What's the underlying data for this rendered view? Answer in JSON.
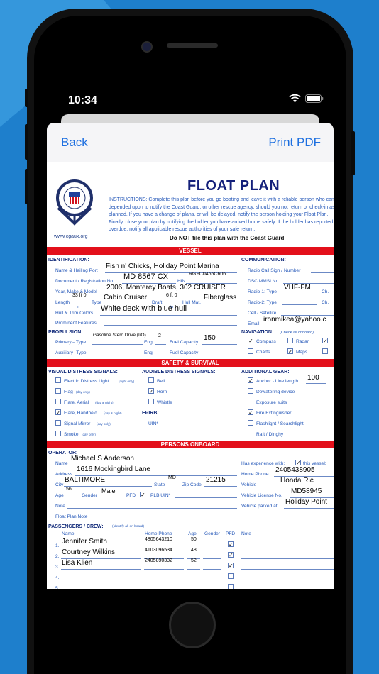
{
  "status": {
    "time": "10:34"
  },
  "nav": {
    "back": "Back",
    "print": "Print PDF"
  },
  "doc": {
    "title": "FLOAT PLAN",
    "site": "www.cgaux.org",
    "instructions": "INSTRUCTIONS: Complete this plan before you go boating and leave it with a reliable person who can be depended upon to notify the Coast Guard, or other rescue agency, should you not return or check-in as planned.  If you have a change of plans, or will be delayed, notify the person holding your Float Plan.  Finally, close your plan by notifying the holder you have arrived home safely. If the holder has reported you overdue, notify all applicable rescue authorities of your safe return.",
    "donot": "Do NOT file this plan with the Coast Guard"
  },
  "sections": {
    "vessel": "VESSEL",
    "safety": "SAFETY & SURVIVAL",
    "persons": "PERSONS ONBOARD"
  },
  "vessel": {
    "identification": "IDENTIFICATION:",
    "name_label": "Name & Hailing Port",
    "name": "Fish n' Chicks, Holiday Point Marina",
    "doc_label": "Document / Registration No.",
    "doc_no": "MD 8567 CX",
    "hin_label": "HIN",
    "hin": "RGFC0465C606",
    "year_label": "Year, Make & Model",
    "year": "2006, Monterey Boats, 302 CRUISER",
    "length_label": "Length",
    "length": "33 ft 0",
    "in1": "in",
    "type_label": "Type",
    "type": "Cabin Cruiser",
    "draft_label": "Draft",
    "draft": "6 ft 0",
    "in2": "in",
    "hull_mat_label": "Hull Mat.",
    "hull_mat": "Fiberglass",
    "colors_label": "Hull & Trim Colors",
    "colors": "White deck with blue hull",
    "features_label": "Prominent Features",
    "propulsion": "PROPULSION:",
    "primary_label": "Primary-- Type",
    "primary": "Gasoline Stern Drive (I/O)",
    "eng_label": "Eng.",
    "eng": "2",
    "fuel_label": "Fuel Capacity",
    "fuel": "150",
    "aux_label": "Auxiliary--Type",
    "eng2_label": "Eng.",
    "fuel2_label": "Fuel Capacity",
    "communication": "COMMUNICATION:",
    "radio_call_label": "Radio Call Sign / Number",
    "dsc_label": "DSC MMSI No.",
    "radio1_label": "Radio-1: Type",
    "radio1": "VHF-FM",
    "ch1": "Ch.",
    "radio2_label": "Radio-2: Type",
    "ch2": "Ch.",
    "cell_label": "Cell / Satellite",
    "email_label": "Email",
    "email": "ironmikea@yahoo.c",
    "navigation": "NAVIGATION:",
    "nav_note": "(Check all onboard)",
    "compass": "Compass",
    "radar": "Radar",
    "charts": "Charts",
    "maps": "Maps"
  },
  "safety": {
    "visual": "VISUAL DISTRESS SIGNALS:",
    "audible": "AUDIBLE DISTRESS SIGNALS:",
    "gear": "ADDITIONAL GEAR:",
    "v1": "Electric Distress Light",
    "v1n": "(night only)",
    "v2": "Flag",
    "v2n": "(day only)",
    "v3": "Flare, Aerial",
    "v3n": "(day & night)",
    "v4": "Flare, Handheld",
    "v4n": "(day & night)",
    "v5": "Signal Mirror",
    "v5n": "(day only)",
    "v6": "Smoke",
    "v6n": "(day only)",
    "a1": "Bell",
    "a2": "Horn",
    "a3": "Whistle",
    "epirb": "EPIRB:",
    "uin": "UIN*",
    "g1": "Anchor - Line length",
    "g1v": "100",
    "g2": "Dewatering device",
    "g3": "Exposure suits",
    "g4": "Fire Extinguisher",
    "g5": "Flashlight / Searchlight",
    "g6": "Raft / Dinghy"
  },
  "operator": {
    "heading": "OPERATOR:",
    "name_label": "Name",
    "name": "Michael S Anderson",
    "address_label": "Address",
    "address": "1616 Mockingbird Lane",
    "city_label": "City",
    "city": "BALTIMORE",
    "state_label": "State",
    "state": "MD",
    "zip_label": "Zip Code",
    "zip": "21215",
    "age_label": "Age",
    "age": "56",
    "gender_label": "Gender",
    "gender": "Male",
    "pfd_label": "PFD",
    "plb_label": "PLB UIN*",
    "note_label": "Note",
    "fp_note_label": "Float Plan Note",
    "exp_label": "Has experience with:",
    "exp_tail": "this vessel;",
    "home_phone_label": "Home Phone",
    "home_phone": "2405438905",
    "vehicle_label": "Vehicle",
    "vehicle": "Honda Ric",
    "license_label": "Vehicle License No.",
    "license": "MD58945",
    "parked_label": "Vehicle parked at",
    "parked": "Holiday Point"
  },
  "crew": {
    "heading": "PASSENGERS / CREW:",
    "heading_note": "(Identify all on board)",
    "col_name": "Name",
    "col_phone": "Home Phone",
    "col_age": "Age",
    "col_gender": "Gender",
    "col_pfd": "PFD",
    "col_note": "Note",
    "rows": [
      {
        "num": "1.",
        "name": "Jennifer Smith",
        "phone": "4805643210",
        "age": "50"
      },
      {
        "num": "2.",
        "name": "Courtney Wilkins",
        "phone": "4103096534",
        "age": "48"
      },
      {
        "num": "3.",
        "name": "Lisa Klien",
        "phone": "2405890332",
        "age": "52"
      },
      {
        "num": "4.",
        "name": "",
        "phone": "",
        "age": ""
      },
      {
        "num": "5.",
        "name": "",
        "phone": "",
        "age": ""
      }
    ]
  }
}
